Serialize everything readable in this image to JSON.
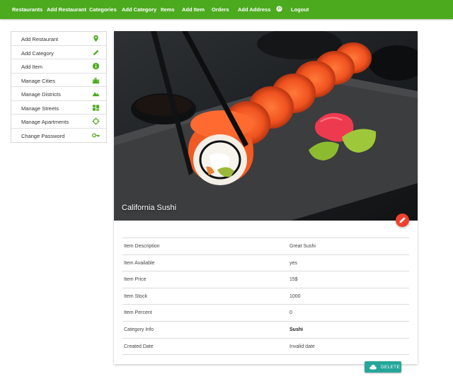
{
  "nav": {
    "links": [
      "Restaurants",
      "Add Restaurant",
      "Categories",
      "Add Category",
      "Items",
      "Add Item",
      "Orders",
      "Add Address",
      "Logout"
    ],
    "globe_icon": "globe-icon"
  },
  "sidebar": {
    "items": [
      {
        "label": "Add Restaurant",
        "icon": "map-pin-icon"
      },
      {
        "label": "Add Category",
        "icon": "pencil-icon"
      },
      {
        "label": "Add Item",
        "icon": "info-icon"
      },
      {
        "label": "Manage Cities",
        "icon": "city-icon"
      },
      {
        "label": "Manage Districts",
        "icon": "terrain-icon"
      },
      {
        "label": "Manage Streets",
        "icon": "map-icon"
      },
      {
        "label": "Manage Apartments",
        "icon": "crosshair-icon"
      },
      {
        "label": "Change Password",
        "icon": "key-icon"
      }
    ]
  },
  "item": {
    "title": "California Sushi",
    "details": [
      {
        "label": "Item Description",
        "value": "Great Sushi"
      },
      {
        "label": "Item Available",
        "value": "yes"
      },
      {
        "label": "Item Price",
        "value": "15$"
      },
      {
        "label": "Item Stock",
        "value": "1000"
      },
      {
        "label": "Item Percent",
        "value": "0"
      },
      {
        "label": "Category Info",
        "value": "Sushi"
      },
      {
        "label": "Created Date",
        "value": "Invalid date"
      }
    ]
  },
  "actions": {
    "delete_label": "DELETE",
    "delete_icon": "cloud-icon",
    "edit_icon": "pencil-icon"
  },
  "colors": {
    "nav_bg": "#4caa1f",
    "icon_green": "#4caa1f",
    "fab": "#f0402f",
    "delete_btn": "#26a69a"
  }
}
